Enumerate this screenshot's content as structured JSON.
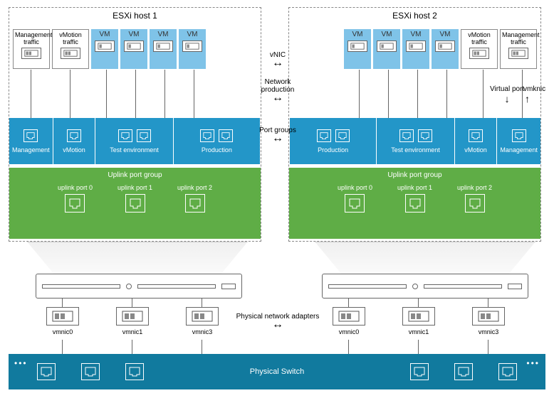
{
  "host1": {
    "title": "ESXi host 1",
    "traffic": {
      "mgmt": "Management traffic",
      "vmotion": "vMotion traffic"
    },
    "vm": "VM"
  },
  "host2": {
    "title": "ESXi host 2",
    "traffic": {
      "mgmt": "Management traffic",
      "vmotion": "vMotion traffic"
    },
    "vm": "VM"
  },
  "portgroups": {
    "mgmt": "Management",
    "vmotion": "vMotion",
    "test": "Test environment",
    "prod": "Production"
  },
  "uplink": {
    "title": "Uplink port group",
    "ports": [
      "uplink port 0",
      "uplink port 1",
      "uplink port 2"
    ]
  },
  "vmnics": [
    "vmnic0",
    "vmnic1",
    "vmnic3"
  ],
  "physical_switch": "Physical Switch",
  "center_labels": {
    "vnic": "vNIC",
    "netprod": "Network production",
    "pg": "Port groups",
    "pna": "Physical network adapters"
  },
  "side_labels": {
    "virtual_port": "Virtual port",
    "vmknic": "vmknic"
  },
  "colors": {
    "vm": "#7fc3e8",
    "pg": "#2396c8",
    "uplink": "#5fad46",
    "switch": "#117a9e"
  }
}
